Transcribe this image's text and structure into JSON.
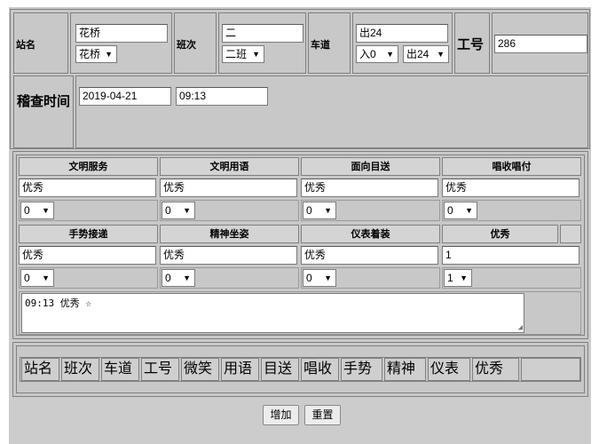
{
  "header_form": {
    "station": {
      "label": "站名",
      "value": "花桥",
      "select": "花桥"
    },
    "shift": {
      "label": "班次",
      "value": "二",
      "select": "二班"
    },
    "lane": {
      "label": "车道",
      "value": "出24",
      "select_dir": "入0",
      "select_lane": "出24"
    },
    "worker_id": {
      "label": "工号",
      "value": "286"
    }
  },
  "inspect_time": {
    "label": "稽查时间",
    "date": "2019-04-21",
    "time": "09:13"
  },
  "scores": {
    "row1": [
      {
        "header": "文明服务",
        "value": "优秀",
        "select": "0"
      },
      {
        "header": "文明用语",
        "value": "优秀",
        "select": "0"
      },
      {
        "header": "面向目送",
        "value": "优秀",
        "select": "0"
      },
      {
        "header": "唱收唱付",
        "value": "优秀",
        "select": "0"
      }
    ],
    "row2": [
      {
        "header": "手势接递",
        "value": "优秀",
        "select": "0"
      },
      {
        "header": "精神坐姿",
        "value": "优秀",
        "select": "0"
      },
      {
        "header": "仪表着装",
        "value": "优秀",
        "select": "0"
      },
      {
        "header": "优秀",
        "value": "1",
        "select": "1"
      }
    ],
    "note": "09:13 优秀 ☆"
  },
  "summary_tags": [
    "站名",
    "班次",
    "车道",
    "工号",
    "微笑",
    "用语",
    "目送",
    "唱收",
    "手势",
    "精神",
    "仪表",
    "优秀",
    ""
  ],
  "buttons": {
    "add": "增加",
    "reset": "重置"
  },
  "icons": {
    "dropdown": "caret-down-icon",
    "resize": "resize-grip-icon"
  }
}
